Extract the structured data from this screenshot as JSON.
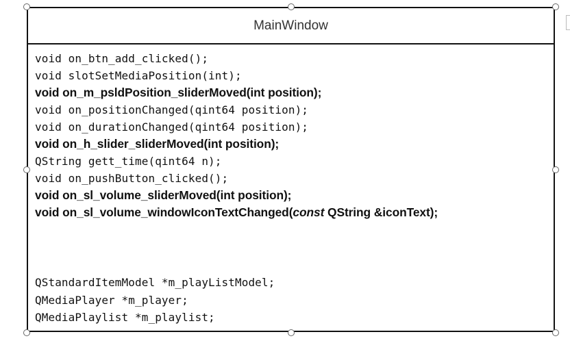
{
  "class_name": "MainWindow",
  "methods": [
    {
      "text": "void on_btn_add_clicked();",
      "style": "mono"
    },
    {
      "text": "void slotSetMediaPosition(int);",
      "style": "mono"
    },
    {
      "text": "void on_m_psldPosition_sliderMoved(int position);",
      "style": "sans"
    },
    {
      "text": "void on_positionChanged(qint64 position);",
      "style": "mono"
    },
    {
      "text": "void on_durationChanged(qint64 position);",
      "style": "mono"
    },
    {
      "text": "void on_h_slider_sliderMoved(int position);",
      "style": "sans"
    },
    {
      "text": "QString gett_time(qint64 n);",
      "style": "mono"
    },
    {
      "text": "void on_pushButton_clicked();",
      "style": "mono"
    },
    {
      "text": "void on_sl_volume_sliderMoved(int position);",
      "style": "sans"
    },
    {
      "prefix": "void on_sl_volume_windowIconTextChanged(",
      "italic": "const",
      "suffix": " QString &iconText);",
      "style": "sans"
    }
  ],
  "fields": [
    "QStandardItemModel *m_playListModel;",
    "QMediaPlayer *m_player;",
    "QMediaPlaylist *m_playlist;"
  ],
  "colors": {
    "border": "#111111",
    "title_text": "#333333",
    "body_text": "#111111",
    "handle_stroke": "#666666"
  }
}
